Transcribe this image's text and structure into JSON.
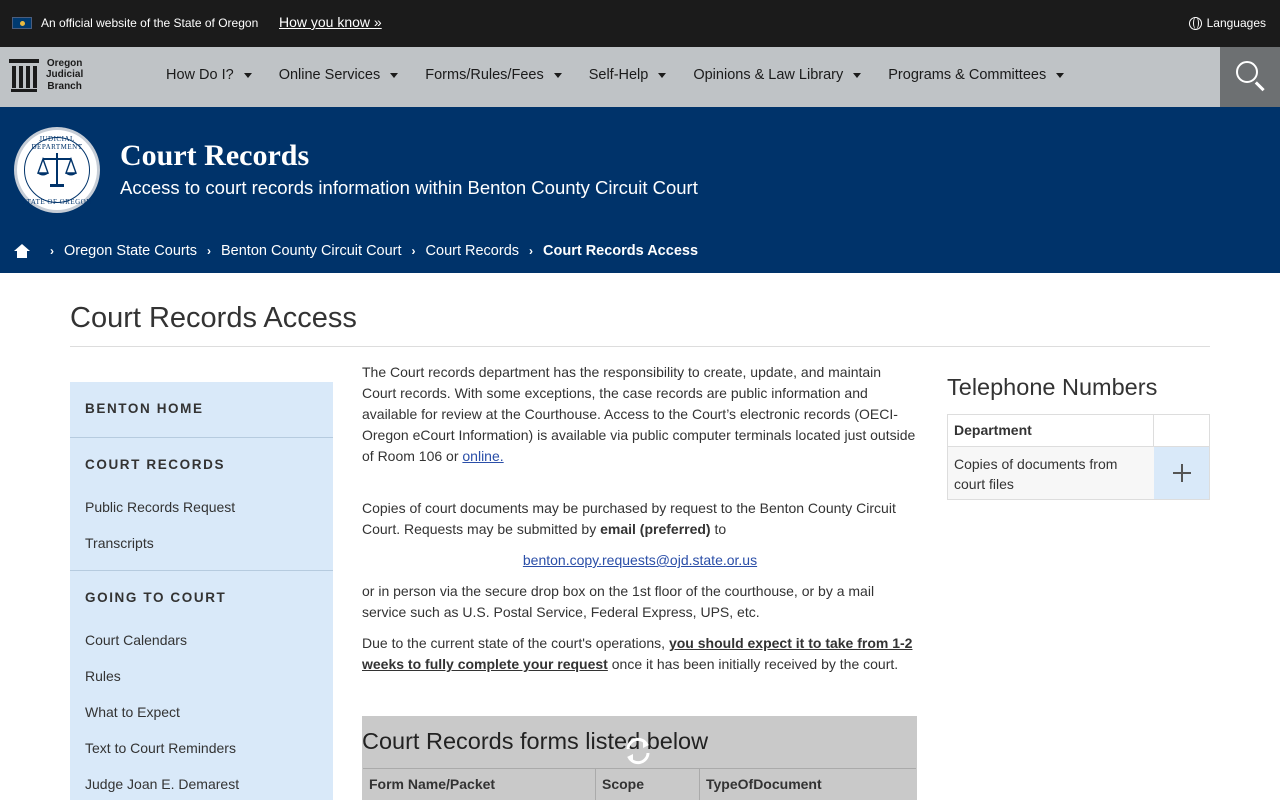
{
  "official_banner": {
    "text": "An official website of the State of Oregon",
    "how_link": "How you know »",
    "languages": "Languages"
  },
  "nav": {
    "logo_lines": [
      "Oregon",
      "Judicial",
      "Branch"
    ],
    "items": [
      {
        "label": "How Do I?"
      },
      {
        "label": "Online Services"
      },
      {
        "label": "Forms/Rules/Fees"
      },
      {
        "label": "Self-Help"
      },
      {
        "label": "Opinions & Law Library"
      },
      {
        "label": "Programs & Committees"
      }
    ]
  },
  "hero": {
    "seal_top": "JUDICIAL DEPARTMENT",
    "seal_bottom": "STATE OF OREGON",
    "title": "Court Records",
    "subtitle": "Access to court records information within Benton County Circuit Court"
  },
  "breadcrumb": {
    "items": [
      "Oregon State Courts",
      "Benton County Circuit Court",
      "Court Records"
    ],
    "current": "Court Records Access"
  },
  "page_title": "Court Records Access",
  "sidebar": {
    "home": "BENTON HOME",
    "section1": "COURT RECORDS",
    "section1_links": [
      "Public Records Request",
      "Transcripts"
    ],
    "section2": "GOING TO COURT",
    "section2_links": [
      "Court Calendars",
      "Rules",
      "What to Expect",
      "Text to Court Reminders",
      "Judge Joan E. Demarest"
    ]
  },
  "content": {
    "p1": "The Court records department has the responsibility to create, update, and maintain Court records.  With some exceptions, the case records are public information and available for review at the Courthouse.   Access to the Court’s electronic records (OECI-Oregon eCourt Information) is available via public computer terminals located just outside of Room 106 or ",
    "p1_link": "online.",
    "p2_start": "Copies of court documents may be purchased by request to the Benton County Circuit Court.  Requests may be submitted by ",
    "p2_bold": "email (preferred)",
    "p2_end": " to",
    "email": "benton.copy.requests@ojd.state.or.us",
    "p3": "or in person via the secure drop box on the 1st floor of the courthouse, or by a mail service such as U.S. Postal Service, Federal Express, UPS, etc.",
    "p4_start": "Due to the current state of the court's operations, ",
    "p4_bold": "you should expect it to take from 1-2 weeks to fully complete your request",
    "p4_end": " once it has been initially received by the court."
  },
  "forms": {
    "title": "Court Records forms listed below",
    "columns": [
      "Form Name/Packet",
      "Scope",
      "TypeOfDocument"
    ]
  },
  "telephone": {
    "title": "Telephone Numbers",
    "header": "Department",
    "rows": [
      {
        "department": "Copies of documents from court files"
      }
    ]
  }
}
